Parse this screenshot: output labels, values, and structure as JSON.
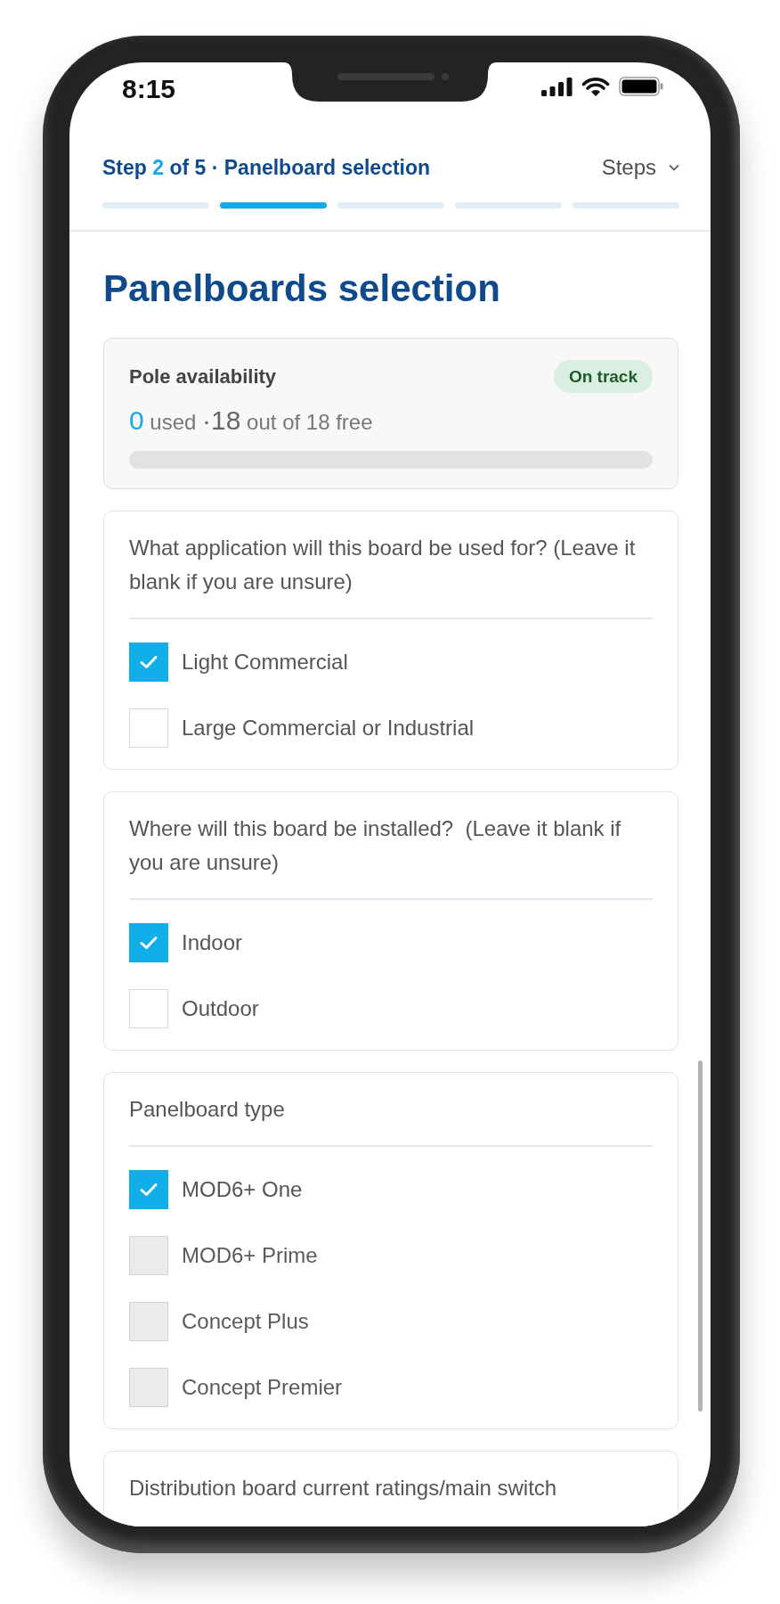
{
  "status_bar": {
    "time": "8:15"
  },
  "header": {
    "step_word": "Step",
    "current_step": "2",
    "step_rest": "of 5 · Panelboard selection",
    "steps_menu": "Steps",
    "segments": [
      {
        "selected": false
      },
      {
        "selected": true
      },
      {
        "selected": false
      },
      {
        "selected": false
      },
      {
        "selected": false
      }
    ]
  },
  "title": "Panelboards selection",
  "pole_availability": {
    "title": "Pole availability",
    "status": "On track",
    "used_count": "0",
    "used_label": "used",
    "free_count": "·18",
    "free_label": "out of 18 free",
    "level": 0
  },
  "sections": [
    {
      "question": "What application will this board be used for? (Leave it blank if you are unsure)",
      "options": [
        {
          "label": "Light Commercial",
          "checked": true,
          "disabled": false
        },
        {
          "label": "Large Commercial or Industrial",
          "checked": false,
          "disabled": false
        }
      ]
    },
    {
      "question": "Where will this board be installed?  (Leave it blank if you are unsure)",
      "options": [
        {
          "label": "Indoor",
          "checked": true,
          "disabled": false
        },
        {
          "label": "Outdoor",
          "checked": false,
          "disabled": false
        }
      ]
    },
    {
      "question": "Panelboard type",
      "options": [
        {
          "label": "MOD6+ One",
          "checked": true,
          "disabled": false
        },
        {
          "label": "MOD6+ Prime",
          "checked": false,
          "disabled": true
        },
        {
          "label": "Concept Plus",
          "checked": false,
          "disabled": true
        },
        {
          "label": "Concept Premier",
          "checked": false,
          "disabled": true
        }
      ]
    },
    {
      "question": "Distribution board current ratings/main switch"
    }
  ]
}
